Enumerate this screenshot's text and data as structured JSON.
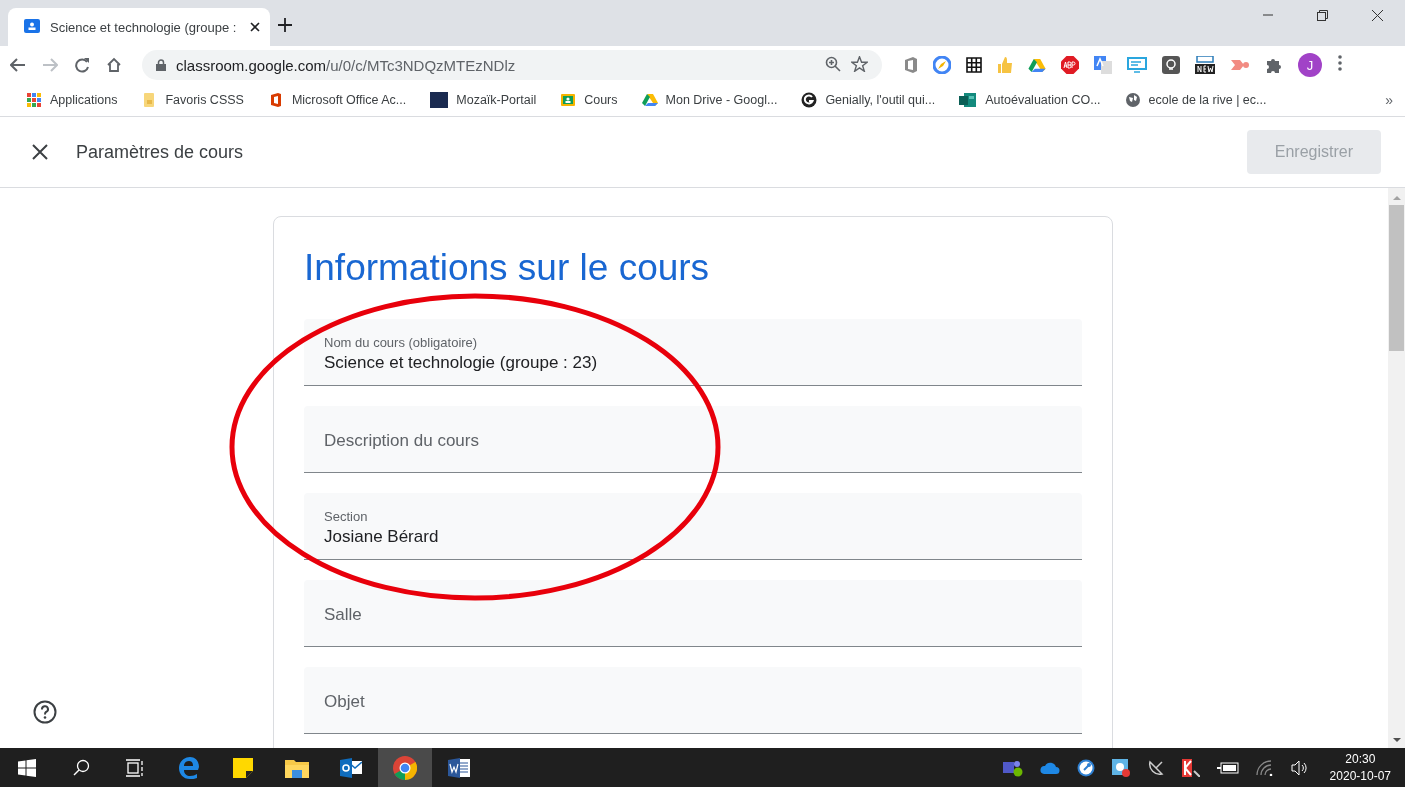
{
  "browser": {
    "tab": {
      "title": "Science et technologie (groupe :",
      "selected": true
    },
    "address": {
      "domain": "classroom.google.com",
      "path": "/u/0/c/MTc3NDQzMTEzNDlz"
    },
    "avatar": "J",
    "bookmarks": [
      {
        "label": "Applications"
      },
      {
        "label": "Favoris CSSS"
      },
      {
        "label": "Microsoft Office Ac..."
      },
      {
        "label": "Mozaïk-Portail"
      },
      {
        "label": "Cours"
      },
      {
        "label": "Mon Drive - Googl..."
      },
      {
        "label": "Genially, l'outil qui..."
      },
      {
        "label": "Autoévaluation CO..."
      },
      {
        "label": "ecole de la rive | ec..."
      }
    ],
    "bookmarks_more": "»"
  },
  "header": {
    "title": "Paramètres de cours",
    "save_button": {
      "label": "Enregistrer",
      "disabled": true
    }
  },
  "card": {
    "title": "Informations sur le cours",
    "fields": [
      {
        "label": "Nom du cours (obligatoire)",
        "value": "Science et technologie (groupe : 23)"
      },
      {
        "placeholder": "Description du cours"
      },
      {
        "label": "Section",
        "value": "Josiane Bérard"
      },
      {
        "placeholder": "Salle"
      },
      {
        "placeholder": "Objet"
      }
    ]
  },
  "taskbar": {
    "time": "20:30",
    "date": "2020-10-07"
  }
}
